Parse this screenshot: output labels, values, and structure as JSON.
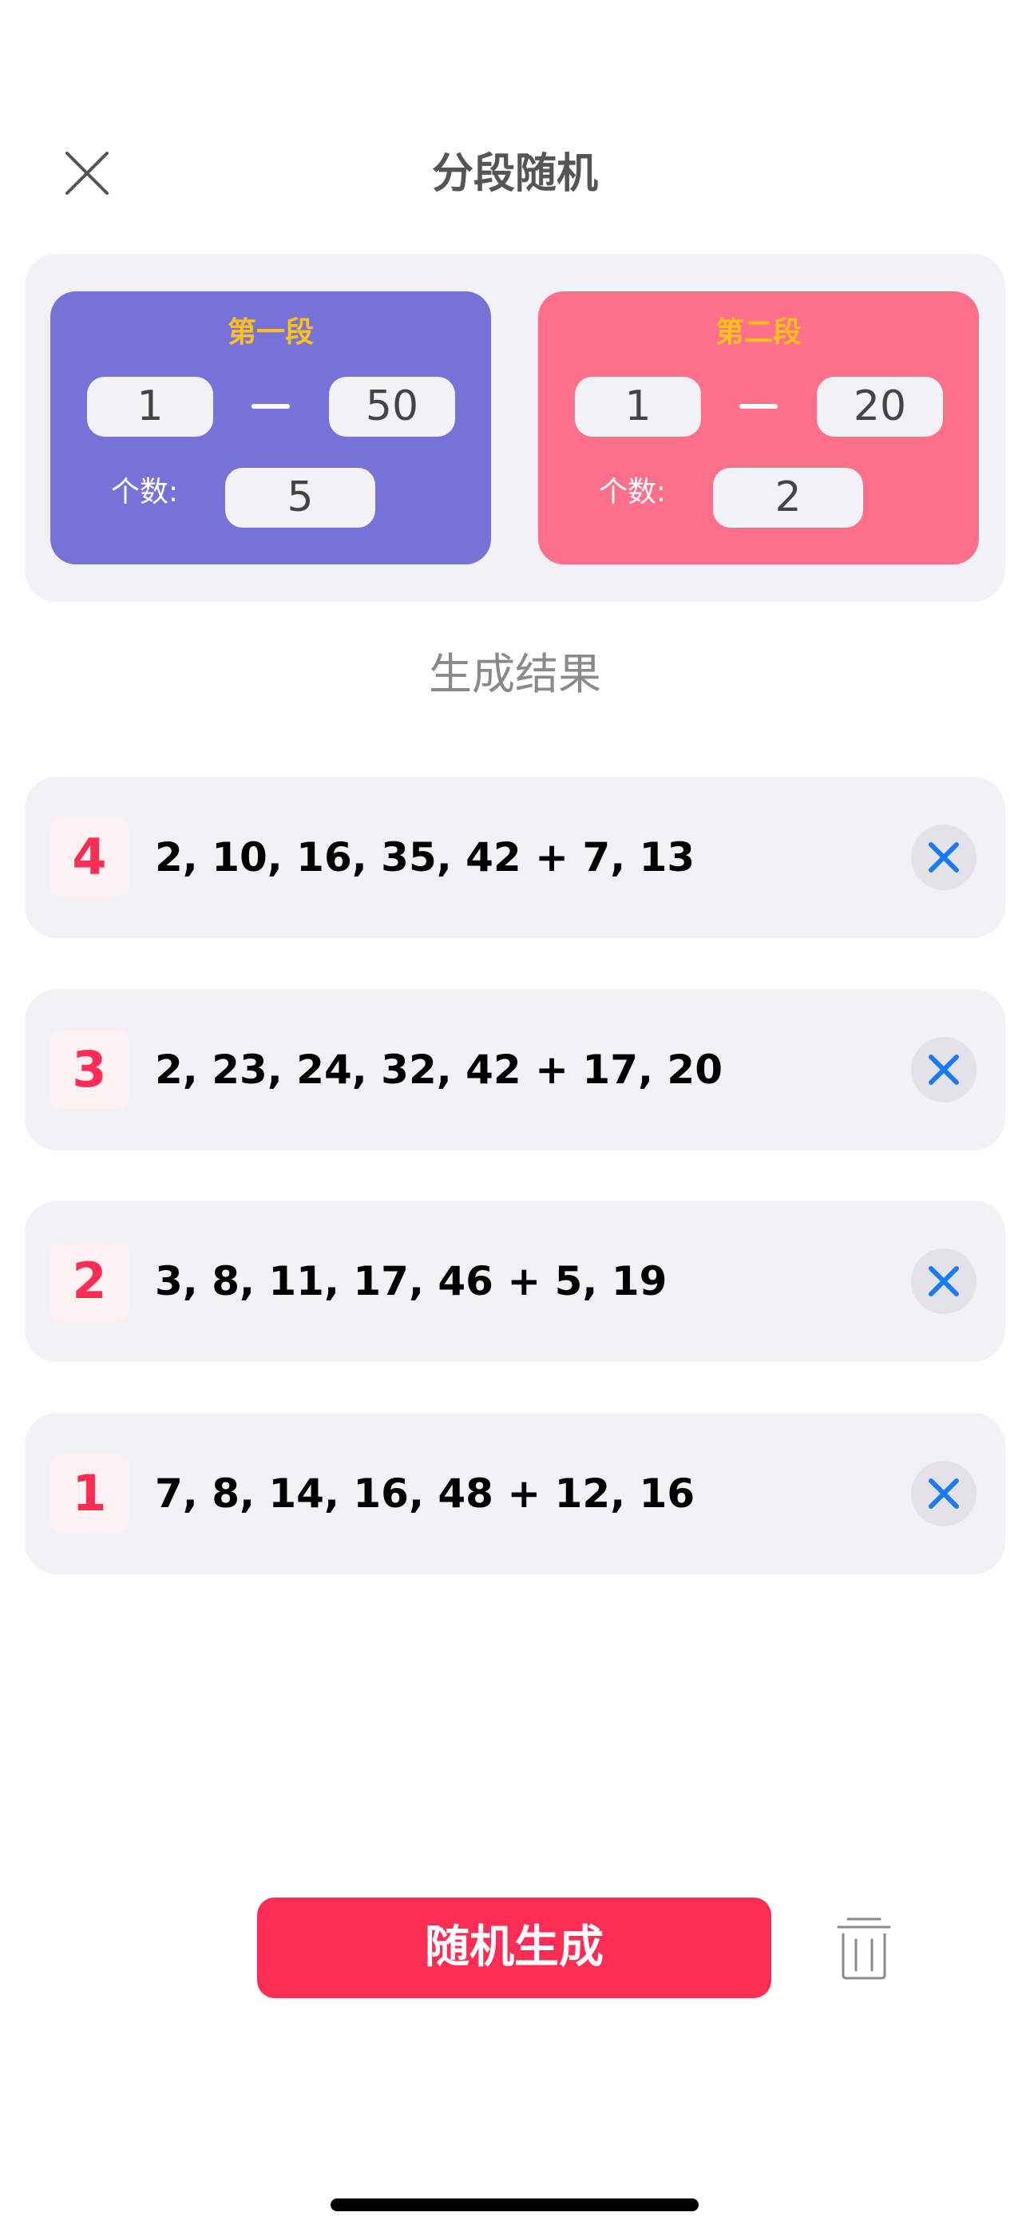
{
  "header": {
    "title": "分段随机",
    "close_icon": "close-icon"
  },
  "segments": [
    {
      "title": "第一段",
      "range_min": "1",
      "range_max": "50",
      "count_label": "个数:",
      "count": "5",
      "color": "#7672d8"
    },
    {
      "title": "第二段",
      "range_min": "1",
      "range_max": "20",
      "count_label": "个数:",
      "count": "2",
      "color": "#fe7089"
    }
  ],
  "results": {
    "title": "生成结果",
    "items": [
      {
        "index": "4",
        "text": "2, 10, 16, 35, 42 + 7, 13"
      },
      {
        "index": "3",
        "text": "2, 23, 24, 32, 42 + 17, 20"
      },
      {
        "index": "2",
        "text": "3, 8, 11, 17, 46 + 5, 19"
      },
      {
        "index": "1",
        "text": "7, 8, 14, 16, 48 + 12, 16"
      }
    ]
  },
  "footer": {
    "generate_label": "随机生成",
    "trash_icon": "trash-icon"
  },
  "colors": {
    "accent": "#fe2d55",
    "segment_title": "#ffc21c",
    "delete_icon": "#1a7cf5",
    "panel_bg": "#f2f1f6"
  }
}
